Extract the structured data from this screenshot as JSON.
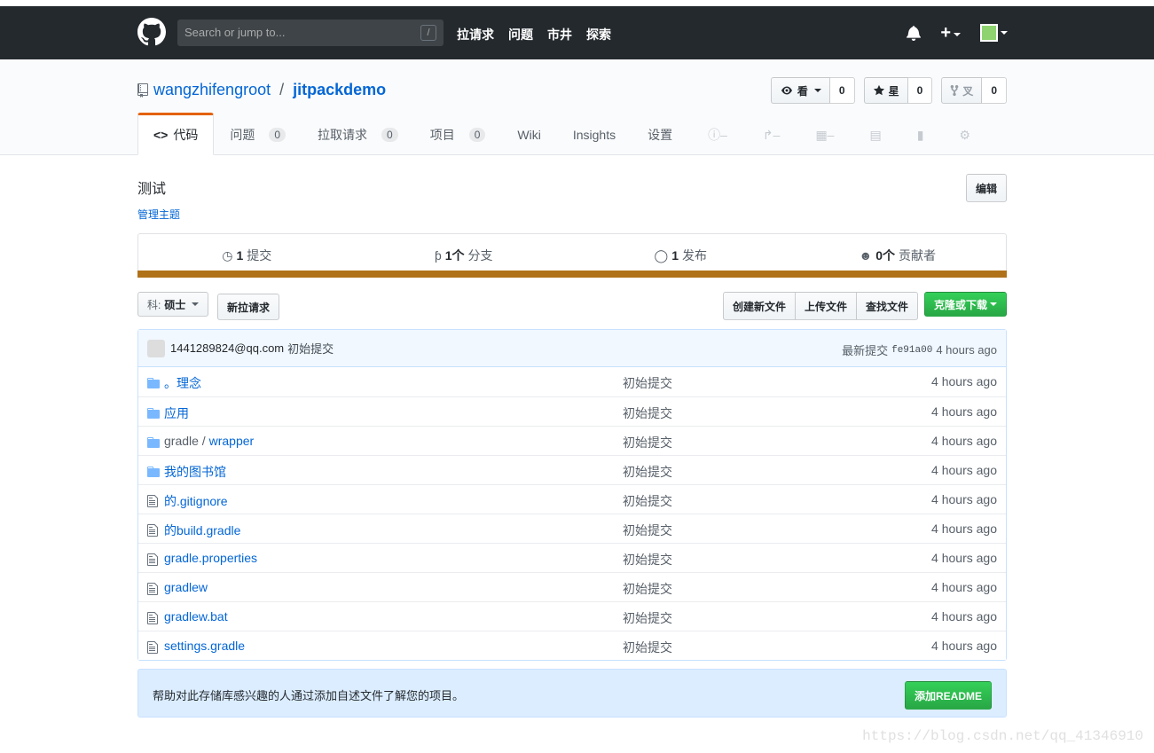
{
  "header": {
    "search_placeholder": "Search or jump to...",
    "search_shortcut": "/",
    "nav": [
      "拉请求",
      "问题",
      "市井",
      "探索"
    ],
    "plus": "+"
  },
  "repo": {
    "owner": "wangzhifengroot",
    "separator": "/",
    "name": "jitpackdemo",
    "actions": {
      "watch_label": "看",
      "watch_count": "0",
      "star_label": "星",
      "star_count": "0",
      "fork_label": "叉",
      "fork_count": "0"
    },
    "tabs": [
      {
        "label": "代码",
        "icon": "code-icon",
        "selected": true
      },
      {
        "label": "问题",
        "count": "0"
      },
      {
        "label": "拉取请求",
        "count": "0"
      },
      {
        "label": "项目",
        "count": "0"
      },
      {
        "label": "Wiki"
      },
      {
        "label": "Insights"
      },
      {
        "label": "设置"
      }
    ]
  },
  "main": {
    "description": "测试",
    "manage_topics": "管理主题",
    "edit_label": "编辑",
    "summary": {
      "commits_num": "1",
      "commits_label": "提交",
      "branches_num": "1个",
      "branches_label": "分支",
      "releases_num": "1",
      "releases_label": "发布",
      "contributors_num": "0个",
      "contributors_label": "贡献者"
    },
    "lang_color": "#b07219",
    "branch_prefix": "科:",
    "branch_name": "硕士",
    "new_pr": "新拉请求",
    "file_buttons": [
      "创建新文件",
      "上传文件",
      "查找文件"
    ],
    "clone_label": "克隆或下载",
    "commit": {
      "author": "1441289824@qq.com",
      "message": "初始提交",
      "latest_label": "最新提交",
      "sha": "fe91a00",
      "age": "4 hours ago"
    },
    "files": [
      {
        "type": "dir",
        "name": "。理念",
        "msg": "初始提交",
        "age": "4 hours ago"
      },
      {
        "type": "dir",
        "name": "应用",
        "msg": "初始提交",
        "age": "4 hours ago"
      },
      {
        "type": "dir",
        "name_plain": "gradle / ",
        "name": "wrapper",
        "msg": "初始提交",
        "age": "4 hours ago"
      },
      {
        "type": "dir",
        "name": "我的图书馆",
        "msg": "初始提交",
        "age": "4 hours ago"
      },
      {
        "type": "file",
        "name": "的.gitignore",
        "msg": "初始提交",
        "age": "4 hours ago"
      },
      {
        "type": "file",
        "name": "的build.gradle",
        "msg": "初始提交",
        "age": "4 hours ago"
      },
      {
        "type": "file",
        "name": "gradle.properties",
        "msg": "初始提交",
        "age": "4 hours ago"
      },
      {
        "type": "file",
        "name": "gradlew",
        "msg": "初始提交",
        "age": "4 hours ago"
      },
      {
        "type": "file",
        "name": "gradlew.bat",
        "msg": "初始提交",
        "age": "4 hours ago"
      },
      {
        "type": "file",
        "name": "settings.gradle",
        "msg": "初始提交",
        "age": "4 hours ago"
      }
    ],
    "readme_prompt": "帮助对此存储库感兴趣的人通过添加自述文件了解您的项目。",
    "add_readme": "添加README"
  },
  "watermark": "https://blog.csdn.net/qq_41346910"
}
